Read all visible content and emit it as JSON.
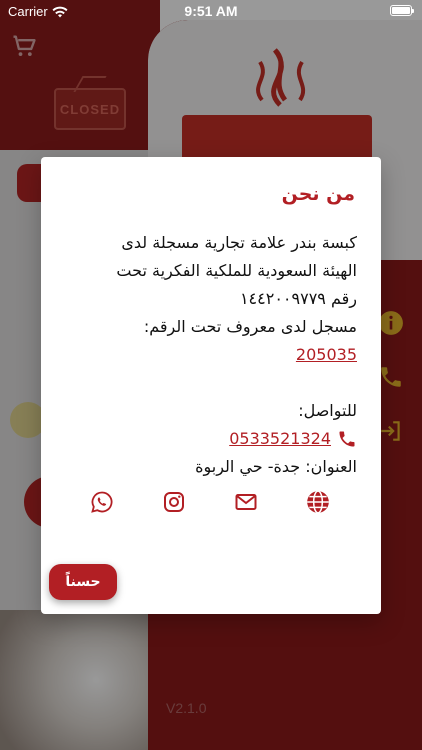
{
  "status_bar": {
    "carrier": "Carrier",
    "time": "9:51 AM"
  },
  "background": {
    "closed_sign": "CLOSED",
    "version": "V2.1.0"
  },
  "dialog": {
    "title": "من نحن",
    "line1": "كبسة بندر علامة تجارية مسجلة لدى",
    "line2": "الهيئة السعودية للملكية الفكرية تحت",
    "line3": "رقم ١٤٤٢٠٠٩٧٧٩",
    "line4": "مسجل لدى معروف تحت الرقم:",
    "maroof_number": "205035",
    "contact_label": "للتواصل:",
    "phone": "0533521324",
    "address": "العنوان: جدة- حي الربوة",
    "ok_label": "حسناً"
  },
  "colors": {
    "accent": "#b21f24",
    "overlay": "rgba(0,0,0,0.4)"
  },
  "icons": [
    "whatsapp-icon",
    "instagram-icon",
    "mail-icon",
    "globe-icon",
    "phone-icon"
  ]
}
